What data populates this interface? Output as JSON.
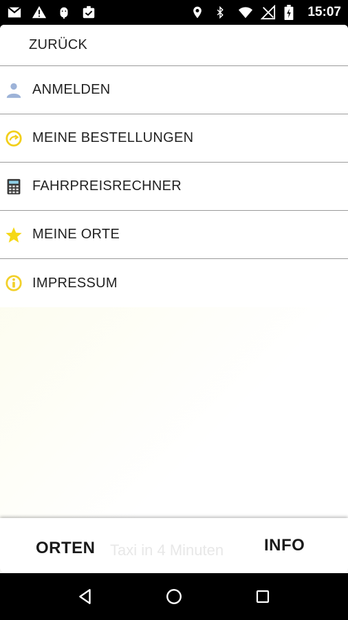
{
  "status_bar": {
    "time": "15:07",
    "left_icons": [
      "gmail-icon",
      "warning-icon",
      "android-debug-icon",
      "clipboard-icon"
    ],
    "right_icons": [
      "location-icon",
      "bluetooth-icon",
      "wifi-icon",
      "no-signal-icon",
      "battery-icon"
    ]
  },
  "menu": {
    "back_label": "ZURÜCK",
    "items": [
      {
        "label": "ANMELDEN",
        "icon": "user-icon"
      },
      {
        "label": "MEINE BESTELLUNGEN",
        "icon": "orders-icon"
      },
      {
        "label": "FAHRPREISRECHNER",
        "icon": "calculator-icon"
      },
      {
        "label": "MEINE ORTE",
        "icon": "star-icon"
      },
      {
        "label": "IMPRESSUM",
        "icon": "info-icon"
      }
    ]
  },
  "bottom_bar": {
    "orten_label": "ORTEN",
    "taxi_text": "Taxi in 4 Minuten",
    "info_label": "INFO"
  },
  "nav_bar": {
    "buttons": [
      "back-nav-icon",
      "home-nav-icon",
      "recents-nav-icon"
    ]
  },
  "colors": {
    "accent_yellow": "#f2d81a",
    "divider": "#9a9a9a"
  }
}
